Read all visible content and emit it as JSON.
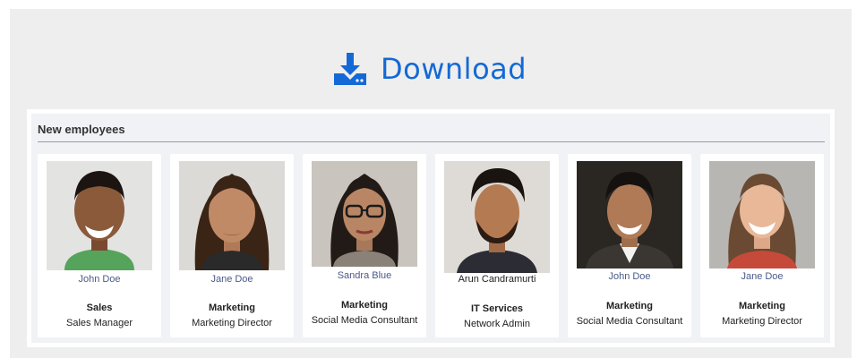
{
  "download": {
    "label": "Download",
    "icon": "download-icon",
    "color": "#1469d6"
  },
  "panel": {
    "title": "New employees"
  },
  "employees": [
    {
      "name": "John Doe",
      "department": "Sales",
      "role": "Sales Manager"
    },
    {
      "name": "Jane Doe",
      "department": "Marketing",
      "role": "Marketing Director"
    },
    {
      "name": "Sandra Blue",
      "department": "Marketing",
      "role": "Social Media Consultant"
    },
    {
      "name": "Arun Candramurti",
      "department": "IT Services",
      "role": "Network Admin"
    },
    {
      "name": "John Doe",
      "department": "Marketing",
      "role": "Social Media Consultant"
    },
    {
      "name": "Jane Doe",
      "department": "Marketing",
      "role": "Marketing Director"
    }
  ]
}
